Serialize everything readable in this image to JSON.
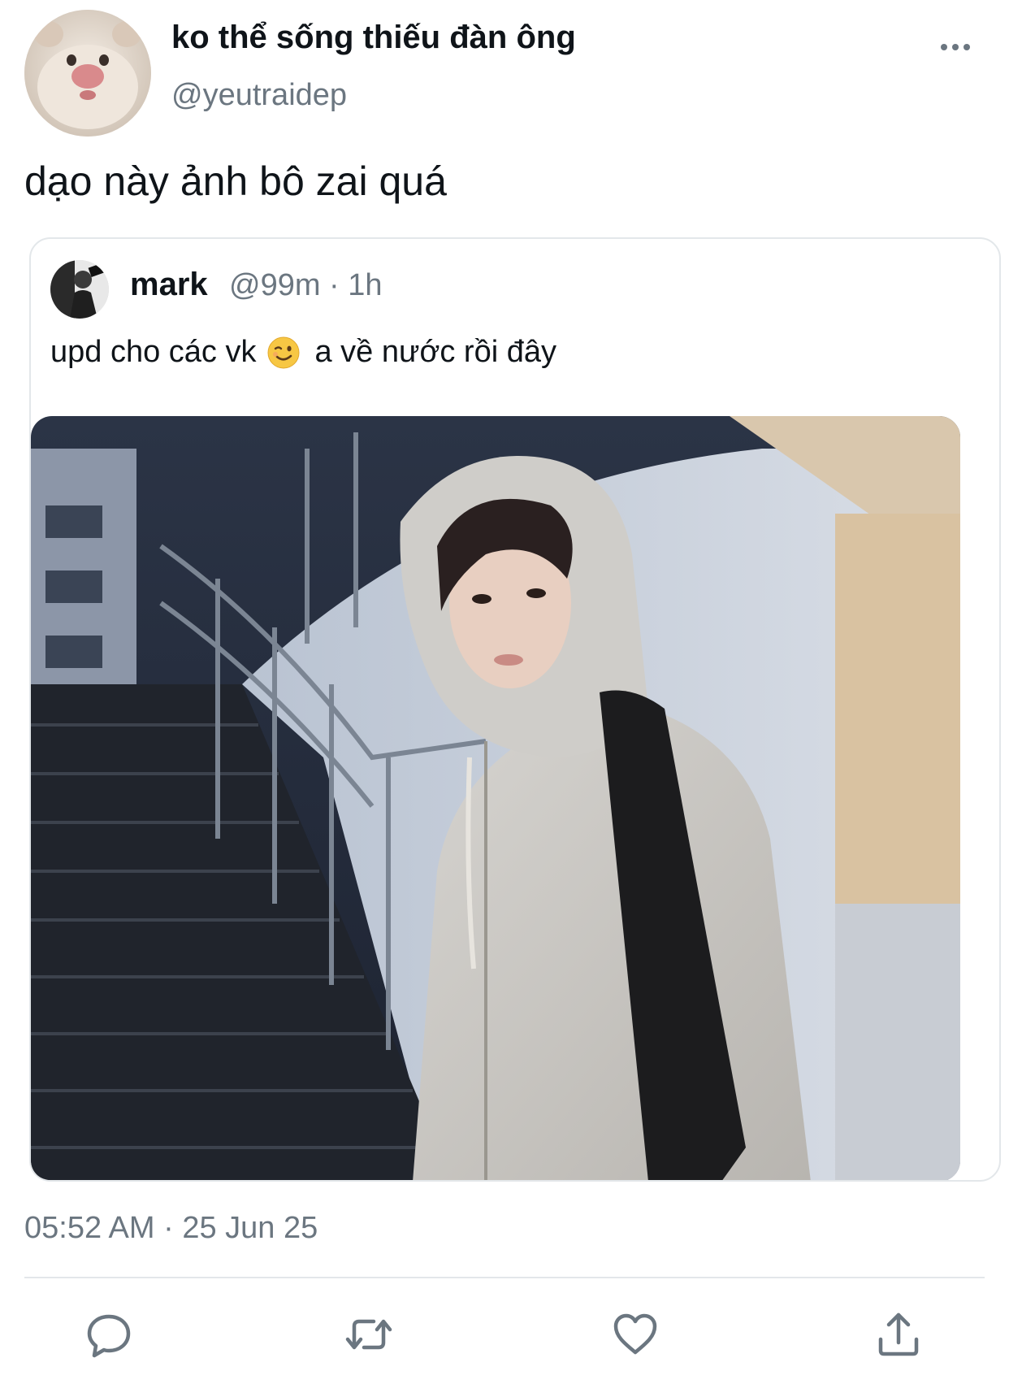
{
  "author": {
    "display_name": "ko thể sống thiếu đàn ông",
    "handle": "@yeutraidep",
    "avatar_icon": "hamster-avatar"
  },
  "tweet": {
    "text": "dạo này ảnh bô zai quá",
    "timestamp": "05:52 AM · 25 Jun 25"
  },
  "quoted": {
    "display_name": "mark",
    "meta": "@99m · 1h",
    "text_before": "upd cho các vk",
    "emoji_icon": "winking-face-emoji",
    "text_after": "a về nước rồi đây",
    "photo_icon": "hoodie-portrait-photo"
  },
  "actions": [
    {
      "icon": "reply-icon"
    },
    {
      "icon": "retweet-icon"
    },
    {
      "icon": "like-icon"
    },
    {
      "icon": "share-icon"
    }
  ],
  "colors": {
    "text_primary": "#0f1419",
    "text_secondary": "#6b7680",
    "border": "#e3e7ea"
  }
}
